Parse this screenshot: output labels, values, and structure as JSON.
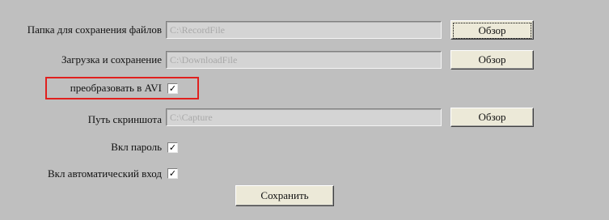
{
  "save_folder": {
    "label": "Папка для сохранения файлов",
    "value": "C:\\RecordFile",
    "browse_label": "Обзор"
  },
  "download_folder": {
    "label": "Загрузка и сохранение",
    "value": "C:\\DownloadFile",
    "browse_label": "Обзор"
  },
  "convert_avi": {
    "label": "преобразовать в AVI",
    "checked": true,
    "check_mark": "✓"
  },
  "screenshot_path": {
    "label": "Путь скриншота",
    "value": "C:\\Capture",
    "browse_label": "Обзор"
  },
  "enable_password": {
    "label": "Вкл пароль",
    "checked": true,
    "check_mark": "✓"
  },
  "auto_login": {
    "label": "Вкл автоматический вход",
    "checked": true,
    "check_mark": "✓"
  },
  "save_button_label": "Сохранить",
  "colors": {
    "background": "#bfbfbf",
    "highlight": "#e0201e",
    "field_text": "#a9a9a9"
  }
}
